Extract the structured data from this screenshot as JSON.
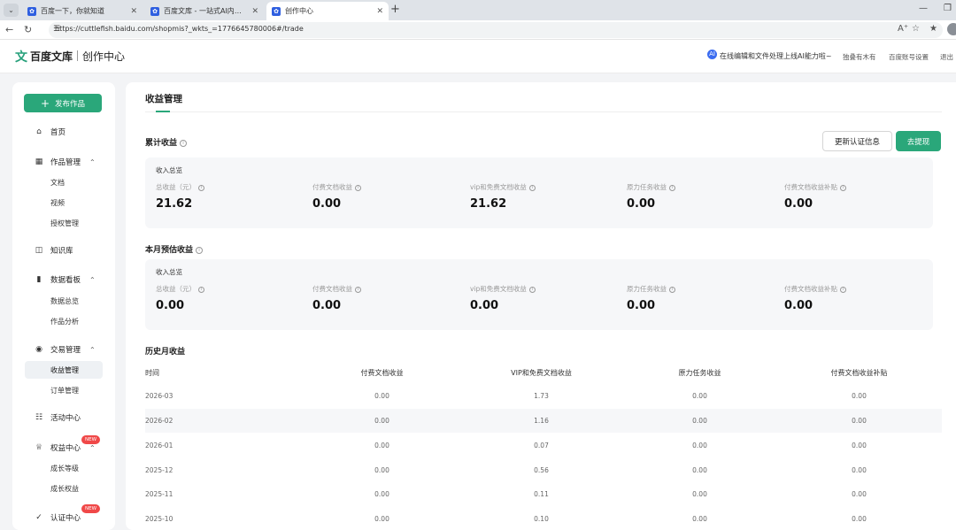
{
  "browser": {
    "tabs": [
      {
        "title": "百度一下，你就知道",
        "active": false
      },
      {
        "title": "百度文库 - 一站式AI内容获取和创作平台",
        "active": false
      },
      {
        "title": "创作中心",
        "active": true
      }
    ],
    "url": "https://cuttlefish.baidu.com/shopmis?_wkts_=1776645780006#/trade"
  },
  "header": {
    "logo_mark": "文",
    "logo_text": "百度文库",
    "logo_sub": "创作中心",
    "ai_badge": "AI",
    "ai_notice": "在线编辑和文件处理上线AI能力啦~",
    "username": "独叠有木有",
    "settings_link": "百度账号设置",
    "logout_link": "退出"
  },
  "sidebar": {
    "publish_label": "发布作品",
    "home": "首页",
    "works": {
      "label": "作品管理",
      "items": [
        "文档",
        "视频",
        "授权管理"
      ]
    },
    "knowledge": "知识库",
    "dashboard": {
      "label": "数据看板",
      "items": [
        "数据总览",
        "作品分析"
      ]
    },
    "trade": {
      "label": "交易管理",
      "items": [
        "收益管理",
        "订单管理"
      ],
      "active_item": "收益管理"
    },
    "activity": "活动中心",
    "rights": {
      "label": "权益中心",
      "badge": "NEW",
      "items": [
        "成长等级",
        "成长权益"
      ]
    },
    "auth": {
      "label": "认证中心",
      "badge": "NEW"
    }
  },
  "main": {
    "title": "收益管理",
    "cumulative": {
      "title": "累计收益",
      "caption": "收入总览",
      "stats": [
        {
          "label": "总收益（元）",
          "value": "21.62"
        },
        {
          "label": "付费文档收益",
          "value": "0.00"
        },
        {
          "label": "vip和免费文档收益",
          "value": "21.62"
        },
        {
          "label": "原力任务收益",
          "value": "0.00"
        },
        {
          "label": "付费文档收益补贴",
          "value": "0.00"
        }
      ]
    },
    "update_cert_button": "更新认证信息",
    "withdraw_button": "去提现",
    "monthly": {
      "title": "本月预估收益",
      "caption": "收入总览",
      "stats": [
        {
          "label": "总收益（元）",
          "value": "0.00"
        },
        {
          "label": "付费文档收益",
          "value": "0.00"
        },
        {
          "label": "vip和免费文档收益",
          "value": "0.00"
        },
        {
          "label": "原力任务收益",
          "value": "0.00"
        },
        {
          "label": "付费文档收益补贴",
          "value": "0.00"
        }
      ]
    },
    "history": {
      "title": "历史月收益",
      "columns": [
        "时间",
        "付费文档收益",
        "VIP和免费文档收益",
        "原力任务收益",
        "付费文档收益补贴"
      ],
      "rows": [
        [
          "2026-03",
          "0.00",
          "1.73",
          "0.00",
          "0.00"
        ],
        [
          "2026-02",
          "0.00",
          "1.16",
          "0.00",
          "0.00"
        ],
        [
          "2026-01",
          "0.00",
          "0.07",
          "0.00",
          "0.00"
        ],
        [
          "2025-12",
          "0.00",
          "0.56",
          "0.00",
          "0.00"
        ],
        [
          "2025-11",
          "0.00",
          "0.11",
          "0.00",
          "0.00"
        ],
        [
          "2025-10",
          "0.00",
          "0.10",
          "0.00",
          "0.00"
        ]
      ]
    }
  },
  "colors": {
    "accent": "#2aa77a",
    "badge": "#f04848",
    "stat_bg": "#f6f7f9"
  }
}
